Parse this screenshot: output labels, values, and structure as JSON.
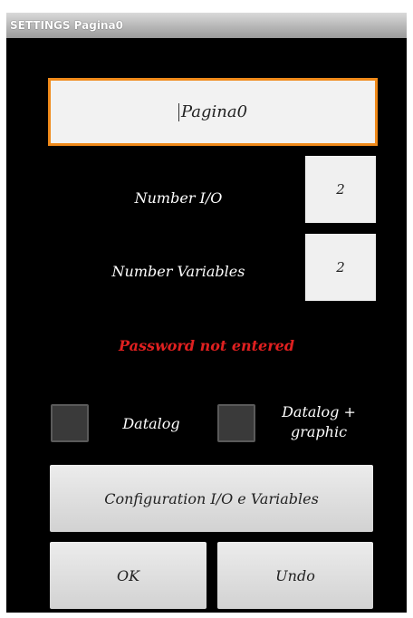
{
  "window": {
    "title": "SETTINGS Pagina0"
  },
  "page": {
    "name_value": "Pagina0",
    "number_io_label": "Number I/O",
    "number_io_value": "2",
    "number_variables_label": "Number Variables",
    "number_variables_value": "2",
    "warning": "Password not entered",
    "datalog_label": "Datalog",
    "datalog_graphic_label_line1": "Datalog +",
    "datalog_graphic_label_line2": "graphic",
    "config_button": "Configuration I/O e Variables",
    "ok_button": "OK",
    "undo_button": "Undo"
  },
  "colors": {
    "background": "#000000",
    "accent_border": "#f08a1a",
    "warning_text": "#e02020"
  }
}
